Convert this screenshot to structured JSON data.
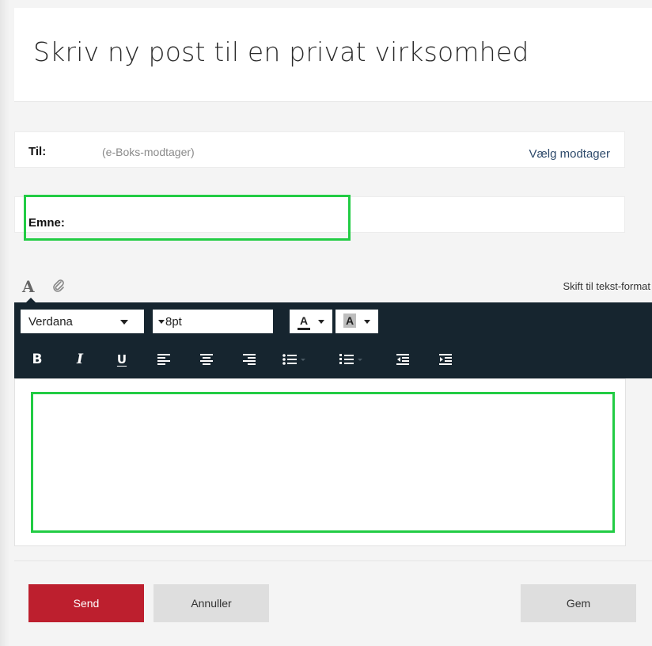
{
  "page": {
    "title": "Skriv ny post til en privat virksomhed"
  },
  "recipient": {
    "label": "Til:",
    "placeholder": "(e-Boks-modtager)",
    "choose_link": "Vælg modtager"
  },
  "subject": {
    "label": "Emne:",
    "value": ""
  },
  "editor": {
    "mode_icons": [
      "font-format-icon",
      "paperclip-icon"
    ],
    "switch_mode_link": "Skift til tekst-format",
    "font_family": "Verdana",
    "font_size": "8pt",
    "text_color_button": "A",
    "highlight_button": "A",
    "format_buttons": [
      "bold",
      "italic",
      "underline",
      "align-left",
      "align-center",
      "align-right",
      "bulleted-list",
      "numbered-list",
      "outdent",
      "indent"
    ],
    "bold_label": "B",
    "italic_label": "I",
    "underline_label": "U",
    "body": ""
  },
  "actions": {
    "send": "Send",
    "cancel": "Annuller",
    "save": "Gem"
  },
  "colors": {
    "send_button": "#bd1f2e",
    "toolbar": "#16252f",
    "highlight_box": "#22cc44",
    "link": "#2e4a6b"
  }
}
